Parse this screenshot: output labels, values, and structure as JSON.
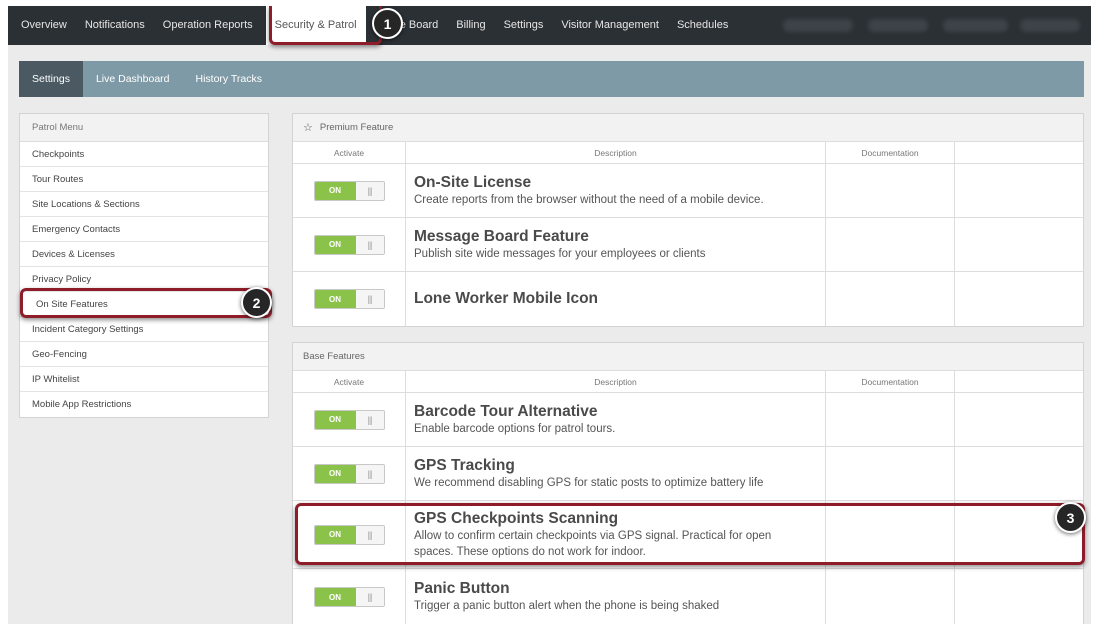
{
  "topnav": {
    "items": [
      "Overview",
      "Notifications",
      "Operation Reports",
      "Security & Patrol",
      "ge Board",
      "Billing",
      "Settings",
      "Visitor Management",
      "Schedules"
    ],
    "active_index": 3
  },
  "subtabs": {
    "items": [
      "Settings",
      "Live Dashboard",
      "History Tracks"
    ],
    "active_index": 0
  },
  "sidebar": {
    "header": "Patrol Menu",
    "items": [
      "Checkpoints",
      "Tour Routes",
      "Site Locations & Sections",
      "Emergency Contacts",
      "Devices & Licenses",
      "Privacy Policy",
      "On Site Features",
      "Incident Category Settings",
      "Geo-Fencing",
      "IP Whitelist",
      "Mobile App Restrictions"
    ],
    "active_index": 6
  },
  "columns": {
    "activate": "Activate",
    "description": "Description",
    "documentation": "Documentation"
  },
  "premium": {
    "header": "Premium Feature",
    "icon": "star-outline-icon",
    "features": [
      {
        "title": "On-Site License",
        "desc": "Create reports from the browser without the need of a mobile device.",
        "toggle": "ON"
      },
      {
        "title": "Message Board Feature",
        "desc": "Publish site wide messages for your employees or clients",
        "toggle": "ON"
      },
      {
        "title": "Lone Worker Mobile Icon",
        "desc": "",
        "toggle": "ON"
      }
    ]
  },
  "base": {
    "header": "Base Features",
    "features": [
      {
        "title": "Barcode Tour Alternative",
        "desc": "Enable barcode options for patrol tours.",
        "toggle": "ON"
      },
      {
        "title": "GPS Tracking",
        "desc": "We recommend disabling GPS for static posts to optimize battery life",
        "toggle": "ON"
      },
      {
        "title": "GPS Checkpoints Scanning",
        "desc": "Allow to confirm certain checkpoints via GPS signal. Practical for open spaces. These options do not work for indoor.",
        "toggle": "ON"
      },
      {
        "title": "Panic Button",
        "desc": "Trigger a panic button alert when the phone is being shaked",
        "toggle": "ON"
      }
    ]
  },
  "annotations": {
    "badges": [
      "1",
      "2",
      "3"
    ],
    "color": "#8e1d2a"
  },
  "colors": {
    "nav_bg": "#2b3035",
    "subbar_bg": "#7f9aa7",
    "toggle_on": "#8bc34a"
  }
}
